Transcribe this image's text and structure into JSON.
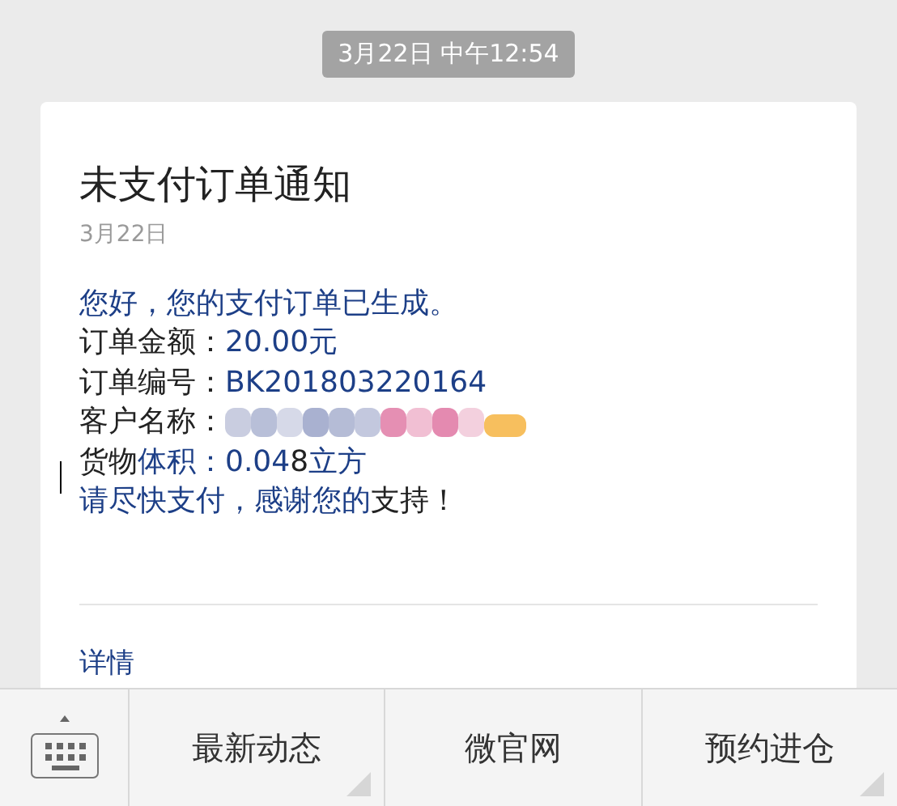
{
  "timestamp": "3月22日 中午12:54",
  "card": {
    "title": "未支付订单通知",
    "date": "3月22日",
    "lines": [
      {
        "kind": "text",
        "segments": [
          {
            "text": "您好，您的支付订单已生成。",
            "highlight": true
          }
        ]
      },
      {
        "kind": "text",
        "segments": [
          {
            "text": "订单金额：",
            "highlight": false
          },
          {
            "text": "20.00元",
            "highlight": true
          }
        ]
      },
      {
        "kind": "text",
        "segments": [
          {
            "text": "订单编号：",
            "highlight": false
          },
          {
            "text": "BK201803220164",
            "highlight": true
          }
        ]
      },
      {
        "kind": "redacted",
        "segments": [
          {
            "text": "客户名称：",
            "highlight": false
          }
        ]
      },
      {
        "kind": "text",
        "segments": [
          {
            "text": "货物",
            "highlight": false
          },
          {
            "text": "体积：0.04",
            "highlight": true
          },
          {
            "text": "8",
            "highlight": false
          },
          {
            "text": "立方",
            "highlight": true
          }
        ]
      },
      {
        "kind": "text",
        "segments": [
          {
            "text": "请尽快支付，感谢您的",
            "highlight": true
          },
          {
            "text": "支持！",
            "highlight": false
          }
        ]
      }
    ],
    "link": "详情"
  },
  "menu": [
    {
      "label": "最新动态",
      "has_submenu": true
    },
    {
      "label": "微官网",
      "has_submenu": false
    },
    {
      "label": "预约进仓",
      "has_submenu": true
    }
  ]
}
